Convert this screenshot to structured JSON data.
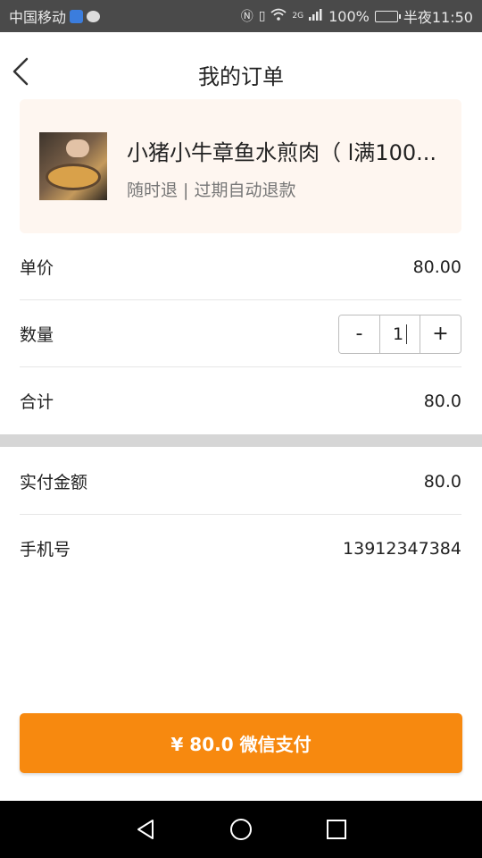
{
  "status_bar": {
    "carrier": "中国移动",
    "network": "2G",
    "battery": "100%",
    "time": "半夜11:50"
  },
  "header": {
    "title": "我的订单",
    "back_icon": "chevron-left-icon"
  },
  "product": {
    "name": "小猪小牛章鱼水煎肉（ l满100...",
    "subtitle": "随时退 | 过期自动退款",
    "thumbnail_icon": "food-photo"
  },
  "order": {
    "unit_price_label": "单价",
    "unit_price": "80.00",
    "quantity_label": "数量",
    "quantity": "1",
    "decrement_label": "-",
    "increment_label": "+",
    "total_label": "合计",
    "total": "80.0"
  },
  "payment": {
    "paid_label": "实付金额",
    "paid_amount": "80.0",
    "phone_label": "手机号",
    "phone": "13912347384"
  },
  "pay_button": {
    "label": "¥ 80.0 微信支付"
  },
  "nav_bar": {
    "back_icon": "triangle-back-icon",
    "home_icon": "circle-home-icon",
    "recent_icon": "square-recents-icon"
  },
  "colors": {
    "accent": "#f7890f",
    "card_background": "#fef6f0",
    "status_bar": "#4a4a4a"
  }
}
